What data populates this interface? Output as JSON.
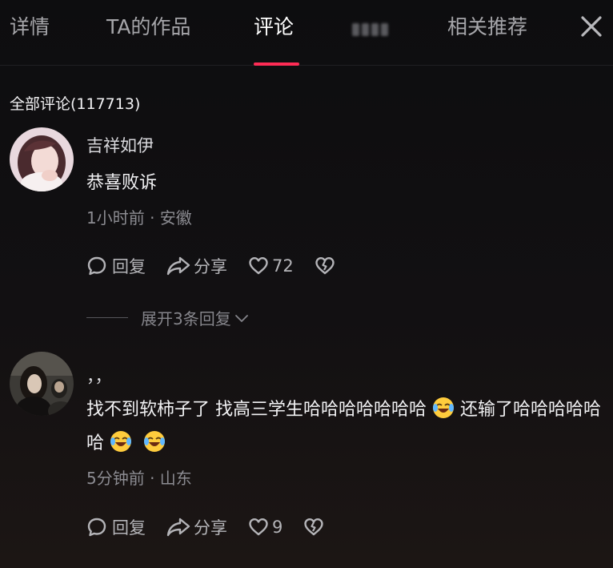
{
  "tabs": [
    {
      "label": "详情",
      "active": false
    },
    {
      "label": "TA的作品",
      "active": false
    },
    {
      "label": "评论",
      "active": true
    },
    {
      "label": "",
      "active": false,
      "blurred": true
    },
    {
      "label": "相关推荐",
      "active": false
    }
  ],
  "close_icon": "close-icon",
  "accent_color": "#fe2c55",
  "section_title": "全部评论(117713)",
  "comments": [
    {
      "username": "吉祥如伊",
      "text": "恭喜败诉",
      "meta": "1小时前 · 安徽",
      "reply_label": "回复",
      "share_label": "分享",
      "like_count": "72",
      "expand_label": "展开3条回复"
    },
    {
      "username": "，，",
      "text_part1": "找不到软柿子了 找高三学生哈哈哈哈哈哈哈",
      "text_part2": "还输了哈哈哈哈哈哈",
      "emoji": "laugh-cry-emoji",
      "meta": "5分钟前 · 山东",
      "reply_label": "回复",
      "share_label": "分享",
      "like_count": "9"
    }
  ]
}
